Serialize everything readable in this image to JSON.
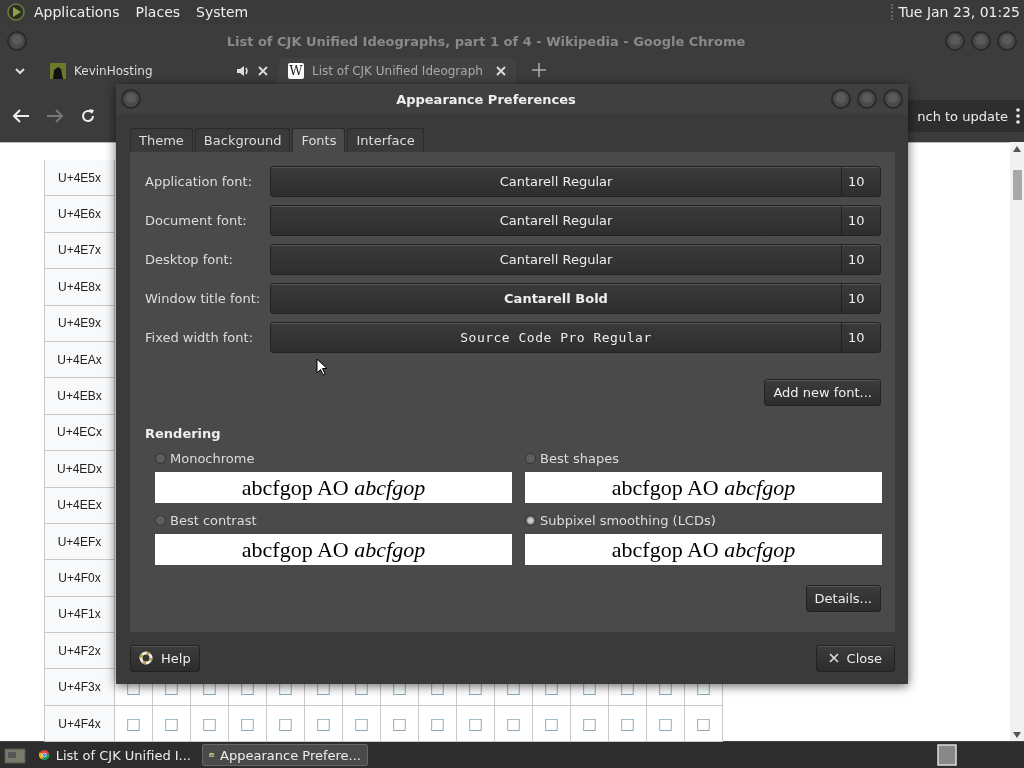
{
  "top_panel": {
    "menus": [
      "Applications",
      "Places",
      "System"
    ],
    "clock": "Tue Jan 23, 01:25"
  },
  "browser": {
    "title": "List of CJK Unified Ideographs, part 1 of 4 - Wikipedia - Google Chrome",
    "tabs": [
      {
        "title": "KevinHosting",
        "selected": false,
        "playing_audio": true,
        "favicon": {
          "kind": "thumbnail"
        }
      },
      {
        "title": "List of CJK Unified Ideograph",
        "selected": true,
        "playing_audio": false,
        "favicon": {
          "kind": "letter",
          "text": "W"
        }
      }
    ],
    "forward_disabled": true,
    "update_button": "nch to update",
    "table": {
      "rows": [
        {
          "header": "U+4E5x"
        },
        {
          "header": "U+4E6x"
        },
        {
          "header": "U+4E7x"
        },
        {
          "header": "U+4E8x"
        },
        {
          "header": "U+4E9x"
        },
        {
          "header": "U+4EAx"
        },
        {
          "header": "U+4EBx"
        },
        {
          "header": "U+4ECx"
        },
        {
          "header": "U+4EDx"
        },
        {
          "header": "U+4EEx"
        },
        {
          "header": "U+4EFx"
        },
        {
          "header": "U+4F0x"
        },
        {
          "header": "U+4F1x"
        },
        {
          "header": "U+4F2x"
        },
        {
          "header": "U+4F3x",
          "cells": [
            "□",
            "□",
            "□",
            "□",
            "□",
            "□",
            "□",
            "□",
            "□",
            "□",
            "□",
            "□",
            "□",
            "□",
            "□",
            "□"
          ]
        },
        {
          "header": "U+4F4x",
          "cells": [
            "□",
            "□",
            "□",
            "□",
            "□",
            "□",
            "□",
            "□",
            "□",
            "□",
            "□",
            "□",
            "□",
            "□",
            "□",
            "□"
          ]
        }
      ]
    }
  },
  "dialog": {
    "title": "Appearance Preferences",
    "tabs": [
      {
        "label": "Theme",
        "selected": false
      },
      {
        "label": "Background",
        "selected": false
      },
      {
        "label": "Fonts",
        "selected": true
      },
      {
        "label": "Interface",
        "selected": false
      }
    ],
    "fonts": [
      {
        "label": "Application font:",
        "font": "Cantarell Regular",
        "size": "10",
        "kind": "regular"
      },
      {
        "label": "Document font:",
        "font": "Cantarell Regular",
        "size": "10",
        "kind": "regular"
      },
      {
        "label": "Desktop font:",
        "font": "Cantarell Regular",
        "size": "10",
        "kind": "regular"
      },
      {
        "label": "Window title font:",
        "font": "Cantarell Bold",
        "size": "10",
        "kind": "bold"
      },
      {
        "label": "Fixed width font:",
        "font": "Source Code Pro Regular",
        "size": "10",
        "kind": "mono"
      }
    ],
    "add_button": "Add new font...",
    "rendering": {
      "heading": "Rendering",
      "options": [
        {
          "label": "Monochrome",
          "selected": false,
          "sample": "abcfgop AO *abcfgop*"
        },
        {
          "label": "Best shapes",
          "selected": false,
          "sample": "abcfgop AO *abcfgop*"
        },
        {
          "label": "Best contrast",
          "selected": false,
          "sample": "abcfgop AO *abcfgop*"
        },
        {
          "label": "Subpixel smoothing (LCDs)",
          "selected": true,
          "sample": "abcfgop AO *abcfgop*"
        }
      ]
    },
    "details_button": "Details...",
    "help_button": "Help",
    "close_button": "Close"
  },
  "taskbar": {
    "items": [
      {
        "label": "List of CJK Unified I...",
        "selected": false,
        "kind": "browser"
      },
      {
        "label": "Appearance Prefere...",
        "selected": true,
        "kind": "preferences"
      }
    ]
  }
}
